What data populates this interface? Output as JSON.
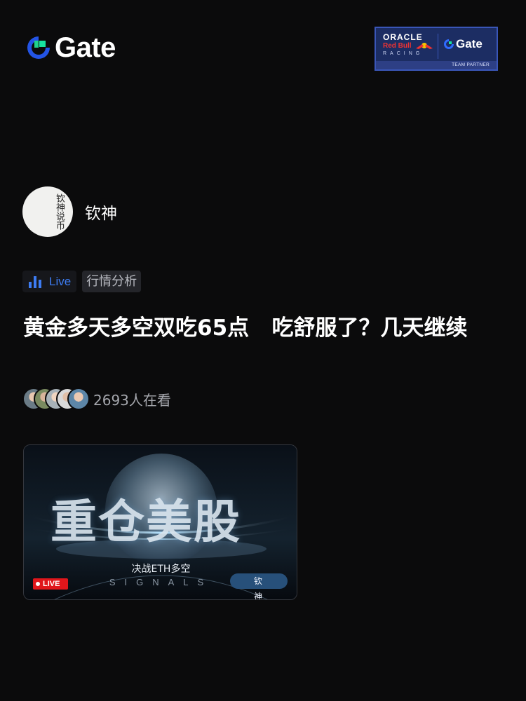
{
  "header": {
    "brand": "Gate",
    "brand_color": "#2354e6",
    "partner": {
      "oracle": "ORACLE",
      "redbull": "Red Bull",
      "racing": "RACING",
      "gate": "Gate",
      "footer": "TEAM PARTNER"
    }
  },
  "author": {
    "name": "钦神",
    "avatar_icon": "calligraphy-avatar",
    "avatar_text": "钦神说币"
  },
  "tags": {
    "live_label": "Live",
    "live_icon": "bar-chart-icon",
    "live_color": "#3d7cf2",
    "topic": "行情分析"
  },
  "post": {
    "title": "黄金多天多空双吃65点   吃舒服了？几天继续"
  },
  "viewers": {
    "text": "2693人在看",
    "count": 5
  },
  "thumbnail": {
    "headline": "重仓美股",
    "subtitle": "决战ETH多空",
    "signals": "SIGNALS",
    "live_badge": "LIVE",
    "author_tag": "钦神"
  }
}
